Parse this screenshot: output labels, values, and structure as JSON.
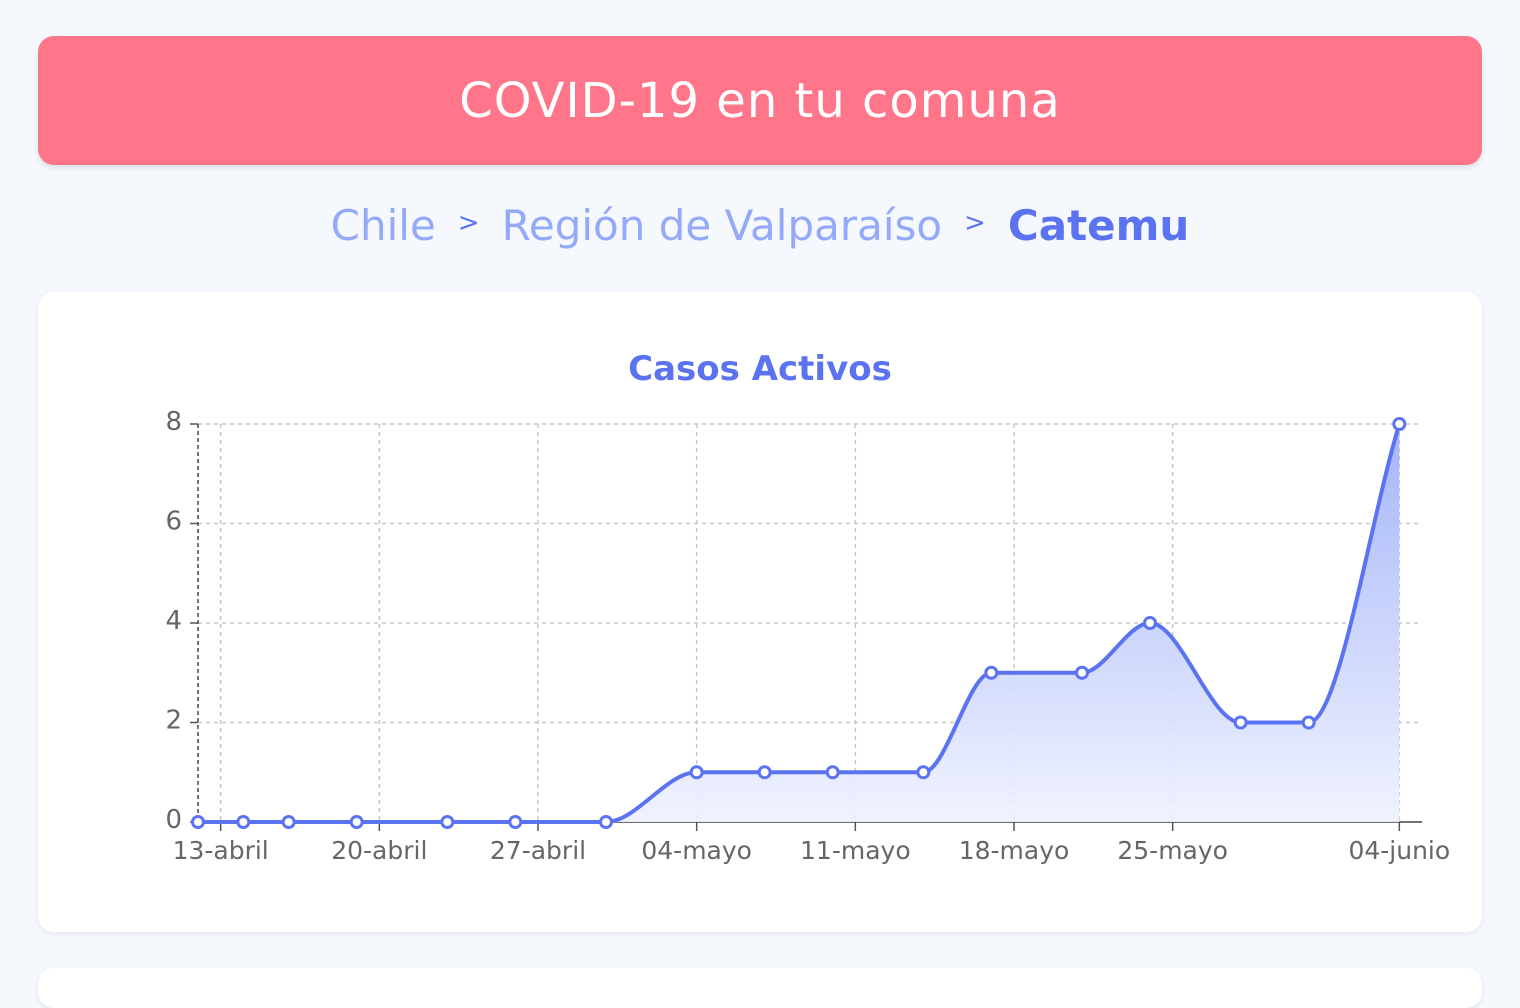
{
  "header": {
    "title": "COVID-19 en tu comuna"
  },
  "breadcrumb": {
    "items": [
      "Chile",
      "Región de Valparaíso"
    ],
    "separator": ">",
    "current": "Catemu"
  },
  "colors": {
    "header_bg": "#ff768b",
    "accent": "#5b73f0",
    "breadcrumb_link": "#94a9f9",
    "area_top": "#9fb1f9",
    "area_bottom": "#eef1fe"
  },
  "chart_data": {
    "type": "area",
    "title": "Casos Activos",
    "xlabel": "",
    "ylabel": "",
    "ylim": [
      0,
      8
    ],
    "y_ticks": [
      0,
      2,
      4,
      6,
      8
    ],
    "x_range": [
      "2020-04-12",
      "2020-06-05"
    ],
    "x_ticks": [
      {
        "date": "2020-04-13",
        "label": "13-abril"
      },
      {
        "date": "2020-04-20",
        "label": "20-abril"
      },
      {
        "date": "2020-04-27",
        "label": "27-abril"
      },
      {
        "date": "2020-05-04",
        "label": "04-mayo"
      },
      {
        "date": "2020-05-11",
        "label": "11-mayo"
      },
      {
        "date": "2020-05-18",
        "label": "18-mayo"
      },
      {
        "date": "2020-05-25",
        "label": "25-mayo"
      },
      {
        "date": "2020-06-04",
        "label": "04-junio"
      }
    ],
    "grid": true,
    "series": [
      {
        "points": [
          {
            "date": "2020-04-12",
            "value": 0
          },
          {
            "date": "2020-04-14",
            "value": 0
          },
          {
            "date": "2020-04-16",
            "value": 0
          },
          {
            "date": "2020-04-19",
            "value": 0
          },
          {
            "date": "2020-04-23",
            "value": 0
          },
          {
            "date": "2020-04-26",
            "value": 0
          },
          {
            "date": "2020-04-30",
            "value": 0
          },
          {
            "date": "2020-05-04",
            "value": 1
          },
          {
            "date": "2020-05-07",
            "value": 1
          },
          {
            "date": "2020-05-10",
            "value": 1
          },
          {
            "date": "2020-05-14",
            "value": 1
          },
          {
            "date": "2020-05-17",
            "value": 3
          },
          {
            "date": "2020-05-21",
            "value": 3
          },
          {
            "date": "2020-05-24",
            "value": 4
          },
          {
            "date": "2020-05-28",
            "value": 2
          },
          {
            "date": "2020-05-31",
            "value": 2
          },
          {
            "date": "2020-06-04",
            "value": 8
          }
        ]
      }
    ]
  }
}
